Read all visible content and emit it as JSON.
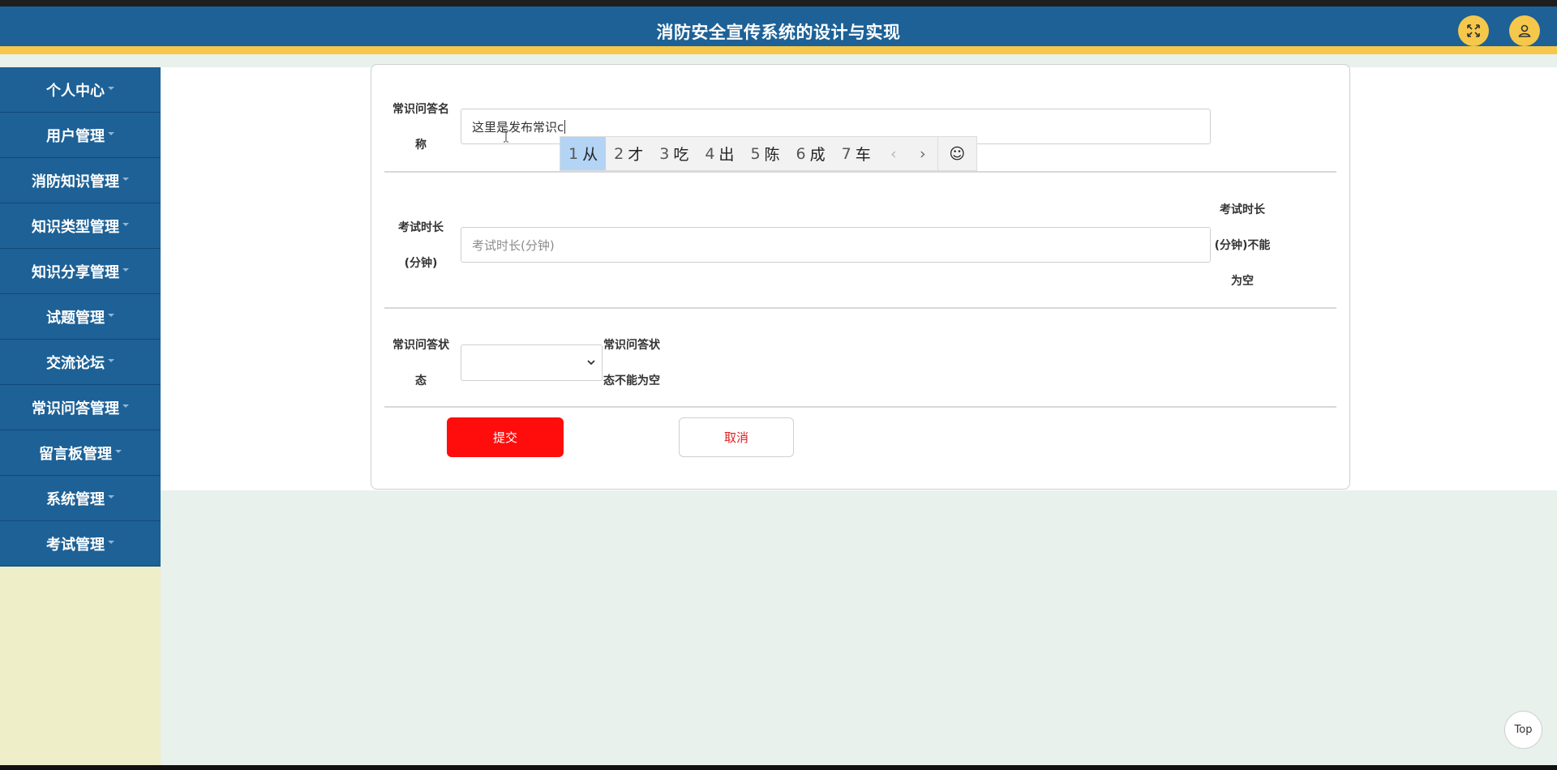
{
  "header": {
    "title": "消防安全宣传系统的设计与实现",
    "fullscreen_icon": "expand-icon",
    "user_icon": "user-icon",
    "accent_color": "#f5c84b",
    "bar_color": "#1d6196"
  },
  "sidebar": {
    "items": [
      {
        "label": "个人中心"
      },
      {
        "label": "用户管理"
      },
      {
        "label": "消防知识管理"
      },
      {
        "label": "知识类型管理"
      },
      {
        "label": "知识分享管理"
      },
      {
        "label": "试题管理"
      },
      {
        "label": "交流论坛"
      },
      {
        "label": "常识问答管理"
      },
      {
        "label": "留言板管理"
      },
      {
        "label": "系统管理"
      },
      {
        "label": "考试管理"
      }
    ]
  },
  "form": {
    "name_field": {
      "label_line1": "常识问答名",
      "label_line2": "称",
      "value": "这里是发布常识c"
    },
    "duration_field": {
      "label_line1": "考试时长",
      "label_line2": "(分钟)",
      "placeholder": "考试时长(分钟)",
      "error_line1": "考试时长",
      "error_line2": "(分钟)不能",
      "error_line3": "为空"
    },
    "status_field": {
      "label_line1": "常识问答状",
      "label_line2": "态",
      "selected": "",
      "error_line1": "常识问答状",
      "error_line2": "态不能为空"
    },
    "submit_label": "提交",
    "cancel_label": "取消"
  },
  "ime": {
    "candidates": [
      {
        "num": "1",
        "char": "从"
      },
      {
        "num": "2",
        "char": "才"
      },
      {
        "num": "3",
        "char": "吃"
      },
      {
        "num": "4",
        "char": "出"
      },
      {
        "num": "5",
        "char": "陈"
      },
      {
        "num": "6",
        "char": "成"
      },
      {
        "num": "7",
        "char": "车"
      }
    ],
    "prev": "‹",
    "next": "›",
    "emoji": "☺"
  },
  "top_button": "Top"
}
